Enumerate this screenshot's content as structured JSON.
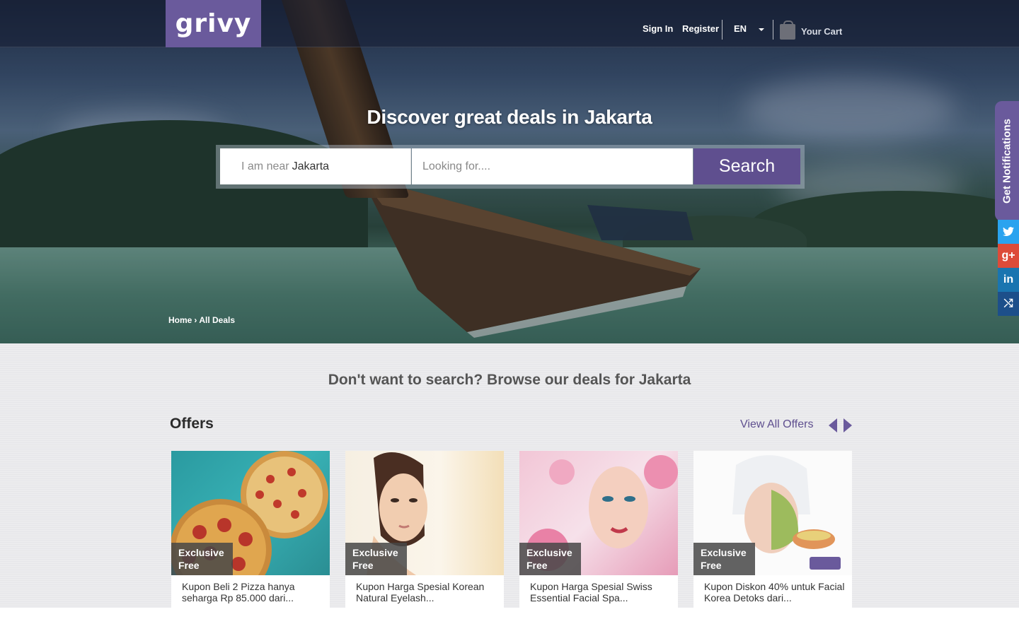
{
  "brand": {
    "logo_text": "grivy",
    "accent": "#6a5a9c"
  },
  "header": {
    "sign_in": "Sign In",
    "register": "Register",
    "language": "EN",
    "cart": "Your Cart"
  },
  "hero": {
    "headline": "Discover great deals in Jakarta",
    "near_prefix": "I am near",
    "near_city": "Jakarta",
    "search_placeholder": "Looking for....",
    "search_button": "Search"
  },
  "breadcrumb": {
    "home": "Home",
    "separator": "›",
    "current": "All Deals"
  },
  "side": {
    "notifications": "Get Notifications",
    "social": [
      {
        "icon": "twitter-icon",
        "glyph": "🐦",
        "color": "#2aa3ef"
      },
      {
        "icon": "google-plus-icon",
        "glyph": "g+",
        "color": "#dd4b39"
      },
      {
        "icon": "linkedin-icon",
        "glyph": "in",
        "color": "#1a75b0"
      },
      {
        "icon": "share-icon",
        "glyph": "⤭",
        "color": "#1d5ea3"
      }
    ]
  },
  "browse": {
    "title": "Don't want to search? Browse our deals for Jakarta",
    "offers_title": "Offers",
    "view_all": "View All Offers"
  },
  "offers": [
    {
      "badge_line1": "Exclusive",
      "badge_line2": "Free",
      "title": "Kupon Beli 2 Pizza hanya seharga Rp 85.000 dari..."
    },
    {
      "badge_line1": "Exclusive",
      "badge_line2": "Free",
      "title": "Kupon Harga Spesial Korean Natural Eyelash..."
    },
    {
      "badge_line1": "Exclusive",
      "badge_line2": "Free",
      "title": "Kupon Harga Spesial Swiss Essential Facial Spa..."
    },
    {
      "badge_line1": "Exclusive",
      "badge_line2": "Free",
      "title": "Kupon Diskon 40% untuk Facial Korea Detoks dari..."
    }
  ]
}
